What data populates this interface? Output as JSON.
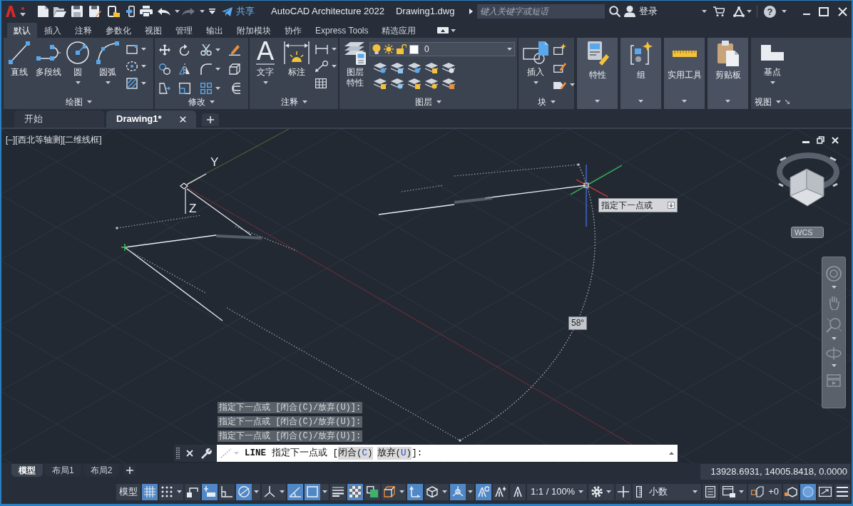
{
  "title_bar": {
    "share": "共享",
    "app_title": "AutoCAD Architecture 2022",
    "document": "Drawing1.dwg",
    "search": {
      "placeholder": "键入关键字或短语"
    },
    "sign_in": "登录",
    "help": "?"
  },
  "ribbon": {
    "tabs": [
      {
        "label": "默认",
        "selected": true
      },
      {
        "label": "插入",
        "selected": false
      },
      {
        "label": "注释",
        "selected": false
      },
      {
        "label": "参数化",
        "selected": false
      },
      {
        "label": "视图",
        "selected": false
      },
      {
        "label": "管理",
        "selected": false
      },
      {
        "label": "输出",
        "selected": false
      },
      {
        "label": "附加模块",
        "selected": false
      },
      {
        "label": "协作",
        "selected": false
      },
      {
        "label": "Express Tools",
        "selected": false
      },
      {
        "label": "精选应用",
        "selected": false
      }
    ],
    "panels": [
      {
        "kind": "draw",
        "title": "绘图",
        "tools": [
          {
            "label": "直线",
            "has_menu": false
          },
          {
            "label": "多段线",
            "has_menu": false
          },
          {
            "label": "圆",
            "has_menu": true
          },
          {
            "label": "圆弧",
            "has_menu": true
          }
        ]
      },
      {
        "kind": "modify",
        "title": "修改"
      },
      {
        "kind": "annotation",
        "title": "注释",
        "tools": [
          {
            "label": "文字",
            "glyph": "A",
            "has_menu": true
          },
          {
            "label": "标注",
            "has_menu": false
          }
        ]
      },
      {
        "kind": "layers",
        "title": "图层",
        "tools": [
          {
            "label": "图层特性",
            "has_menu": false
          }
        ],
        "layer": {
          "name": "0",
          "on": true,
          "frozen": false,
          "locked": false
        }
      },
      {
        "kind": "block",
        "title": "块",
        "tools": [
          {
            "label": "插入",
            "has_menu": true
          }
        ]
      },
      {
        "kind": "properties",
        "title": "特性"
      },
      {
        "kind": "groups",
        "title": "组"
      },
      {
        "kind": "utilities",
        "title": "实用工具"
      },
      {
        "kind": "clipboard",
        "title": "剪贴板"
      },
      {
        "kind": "view",
        "title": "视图",
        "tools": [
          {
            "label": "基点",
            "has_menu": true
          }
        ]
      }
    ]
  },
  "document_tabs": [
    {
      "label": "开始",
      "selected": false,
      "closable": false
    },
    {
      "label": "Drawing1*",
      "selected": true,
      "closable": true
    }
  ],
  "viewport": {
    "controls": [
      "[–]",
      "[西北等轴测]",
      "[二维线框]"
    ],
    "ucs_labels": {
      "y": "Y",
      "z": "Z"
    },
    "tooltip": "指定下一点或",
    "angle": "58°",
    "wcs": "WCS"
  },
  "command_line": {
    "history": [
      "指定下一点或 [闭合(C)/放弃(U)]:",
      "指定下一点或 [闭合(C)/放弃(U)]:",
      "指定下一点或 [闭合(C)/放弃(U)]:"
    ],
    "command": "LINE",
    "prompt": "指定下一点或 [",
    "options": [
      {
        "before": "闭合(",
        "key": "C",
        "after": ")"
      },
      {
        "before": "放弃(",
        "key": "U",
        "after": ")"
      }
    ],
    "suffix": "]:"
  },
  "layout_tabs": [
    {
      "label": "模型",
      "selected": true
    },
    {
      "label": "布局1",
      "selected": false
    },
    {
      "label": "布局2",
      "selected": false
    }
  ],
  "coordinates": "13928.6931, 14005.8418, 0.0000",
  "status_bar": {
    "space": "模型",
    "toggles": [
      {
        "kind": "grid",
        "on": true
      },
      {
        "kind": "snap",
        "on": false
      },
      {
        "kind": "infer",
        "on": false
      },
      {
        "kind": "dyninput",
        "on": true
      },
      {
        "kind": "ortho",
        "on": false
      },
      {
        "kind": "polar",
        "on": true
      },
      {
        "kind": "isodraft",
        "on": false
      },
      {
        "kind": "otrack",
        "on": true
      },
      {
        "kind": "osnap",
        "on": true
      },
      {
        "kind": "lineweight",
        "on": false
      },
      {
        "kind": "transparency",
        "on": true
      },
      {
        "kind": "selcycle",
        "on": false
      },
      {
        "kind": "osnap3d",
        "on": false
      },
      {
        "kind": "ducs",
        "on": true
      },
      {
        "kind": "selfilter",
        "on": false
      },
      {
        "kind": "gizmo",
        "on": true
      },
      {
        "kind": "annovis",
        "on": true
      },
      {
        "kind": "autoscale",
        "on": false
      },
      {
        "kind": "annoscale",
        "on": false
      }
    ],
    "annotation_scale": "1:1 / 100%",
    "units": "小数",
    "isolate_count": "+0",
    "display_toggles": [
      {
        "kind": "hardware",
        "on": false
      },
      {
        "kind": "cleanscreen",
        "on": true
      }
    ]
  }
}
